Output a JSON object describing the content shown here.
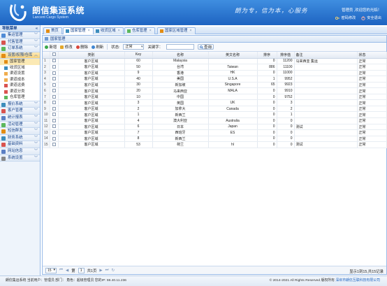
{
  "header": {
    "title": "朗信集运系统",
    "subtitle": "Lancent Cargo System",
    "slogan": "朗为专，信为本，心服务",
    "welcome": "管理员 ,欢迎您的光临！",
    "password_link": "密码修改",
    "logout_link": "安全退出"
  },
  "sidebar": {
    "title": "导航菜单",
    "groups_top": [
      {
        "label": "集运管理",
        "color": "#4f8bd6"
      },
      {
        "label": "代售管理",
        "color": "#d9534f"
      },
      {
        "label": "订单系统",
        "color": "#5cb85c"
      }
    ],
    "open_group": {
      "label": "设置/权限/仓库",
      "color": "#e38d13"
    },
    "sub_items": [
      {
        "label": "国家管理",
        "color": "#e38d13",
        "active": true
      },
      {
        "label": "收货区域",
        "color": "#3c8dbc",
        "active": false
      },
      {
        "label": "渠道设置",
        "color": "#f0ad4e",
        "active": false
      },
      {
        "label": "渠道成本",
        "color": "#f0ad4e",
        "active": false
      },
      {
        "label": "渠道运费",
        "color": "#d9534f",
        "active": false
      },
      {
        "label": "渠道分类",
        "color": "#d9534f",
        "active": false
      },
      {
        "label": "仓库管理",
        "color": "#5cb85c",
        "active": false
      }
    ],
    "groups_bottom": [
      {
        "label": "报价系统",
        "color": "#3c8dbc"
      },
      {
        "label": "客户管理",
        "color": "#d9534f"
      },
      {
        "label": "统计报表",
        "color": "#5b7fc4"
      },
      {
        "label": "活动管理",
        "color": "#5cb85c"
      },
      {
        "label": "短信群发",
        "color": "#e38d13"
      },
      {
        "label": "财务系统",
        "color": "#3c8dbc"
      },
      {
        "label": "基础资料",
        "color": "#d9534f"
      },
      {
        "label": "网站信息",
        "color": "#5b7fc4"
      },
      {
        "label": "系统设置",
        "color": "#888888"
      }
    ]
  },
  "tabs": [
    {
      "label": "首页",
      "closable": false,
      "active": false
    },
    {
      "label": "国家管理",
      "closable": true,
      "active": true
    },
    {
      "label": "收货区域",
      "closable": true,
      "active": false
    },
    {
      "label": "仓库管理",
      "closable": true,
      "active": false
    },
    {
      "label": "国家区域管理",
      "closable": true,
      "active": false
    }
  ],
  "panel": {
    "title": "国家管理"
  },
  "toolbar": {
    "add": "新增",
    "edit": "修改",
    "delete": "删除",
    "refresh": "刷新",
    "status_label": "状态:",
    "status_value": "正常",
    "keyword_label": "关键字：",
    "keyword_value": "",
    "search": "查询"
  },
  "table": {
    "columns": [
      "类别",
      "Key",
      "名称",
      "英文名称",
      "排序",
      "排序值",
      "备注",
      "状态"
    ],
    "rows": [
      {
        "n": "1",
        "cat": "客户区域",
        "key": "60",
        "name": "Malaysia",
        "en": "",
        "ord": "0",
        "val": "11200",
        "note": "马来西亚 集运",
        "st": "正常"
      },
      {
        "n": "2",
        "cat": "客户区域",
        "key": "50",
        "name": "台湾",
        "en": "Taiwan",
        "ord": "886",
        "val": "11100",
        "note": "",
        "st": "正常"
      },
      {
        "n": "3",
        "cat": "客户区域",
        "key": "9",
        "name": "香港",
        "en": "HK",
        "ord": "0",
        "val": "11000",
        "note": "",
        "st": "正常"
      },
      {
        "n": "4",
        "cat": "客户区域",
        "key": "40",
        "name": "美国",
        "en": "U.S.A",
        "ord": "1",
        "val": "9952",
        "note": "",
        "st": "正常"
      },
      {
        "n": "5",
        "cat": "客户区域",
        "key": "30",
        "name": "新加坡",
        "en": "Singapore",
        "ord": "65",
        "val": "9923",
        "note": "",
        "st": "正常"
      },
      {
        "n": "6",
        "cat": "客户区域",
        "key": "20",
        "name": "马来西亚",
        "en": "MALA",
        "ord": "0",
        "val": "9910",
        "note": "",
        "st": "正常"
      },
      {
        "n": "7",
        "cat": "客户区域",
        "key": "10",
        "name": "中国",
        "en": "",
        "ord": "0",
        "val": "9752",
        "note": "",
        "st": "正常"
      },
      {
        "n": "8",
        "cat": "客户区域",
        "key": "3",
        "name": "英国",
        "en": "UK",
        "ord": "0",
        "val": "3",
        "note": "",
        "st": "正常"
      },
      {
        "n": "9",
        "cat": "客户区域",
        "key": "2",
        "name": "加拿大",
        "en": "Canada",
        "ord": "0",
        "val": "2",
        "note": "",
        "st": "正常"
      },
      {
        "n": "10",
        "cat": "客户区域",
        "key": "1",
        "name": "新西兰",
        "en": "",
        "ord": "0",
        "val": "1",
        "note": "",
        "st": "正常"
      },
      {
        "n": "11",
        "cat": "客户区域",
        "key": "4",
        "name": "澳大利亚",
        "en": "Australia",
        "ord": "0",
        "val": "0",
        "note": "",
        "st": "正常"
      },
      {
        "n": "12",
        "cat": "客户区域",
        "key": "6",
        "name": "日本",
        "en": "Japan",
        "ord": "0",
        "val": "0",
        "note": "测试",
        "st": "正常"
      },
      {
        "n": "13",
        "cat": "客户区域",
        "key": "7",
        "name": "西班牙",
        "en": "ES",
        "ord": "0",
        "val": "0",
        "note": "",
        "st": "正常"
      },
      {
        "n": "14",
        "cat": "客户区域",
        "key": "8",
        "name": "新西兰",
        "en": "",
        "ord": "0",
        "val": "0",
        "note": "",
        "st": "正常"
      },
      {
        "n": "15",
        "cat": "客户区域",
        "key": "53",
        "name": "荷兰",
        "en": "hl",
        "ord": "0",
        "val": "0",
        "note": "测试",
        "st": "正常"
      }
    ]
  },
  "pager": {
    "page_size": "15",
    "page_prefix": "第",
    "page": "1",
    "page_suffix": "共1页",
    "info": "显示1到15,共15记录"
  },
  "footer": {
    "left": "朗信集运系统 当前用户：管理员 部门： 角色：超级管理员 您的IP: 59.40.11.236",
    "copyright": "© 2014-2021 All Rights Reserved 版权所有",
    "company": "深圳市朗信互联科技有限公司"
  }
}
